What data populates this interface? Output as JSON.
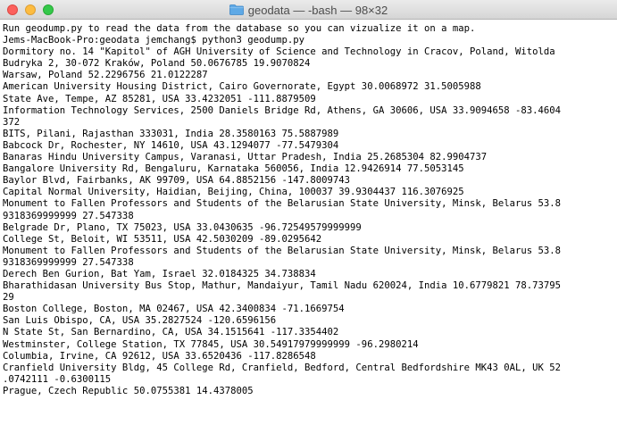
{
  "window": {
    "title": "geodata — -bash — 98×32",
    "icon": "folder-icon",
    "colors": {
      "close": "#fc605c",
      "minimize": "#fdbc40",
      "zoom": "#34c84a",
      "folder": "#5ea9e6"
    }
  },
  "terminal": {
    "lines": [
      "Run geodump.py to read the data from the database so you can vizualize it on a map.",
      "Jems-MacBook-Pro:geodata jemchang$ python3 geodump.py",
      "Dormitory no. 14 \"Kapitol\" of AGH University of Science and Technology in Cracov, Poland, Witolda",
      "Budryka 2, 30-072 Kraków, Poland 50.0676785 19.9070824",
      "Warsaw, Poland 52.2296756 21.0122287",
      "American University Housing District, Cairo Governorate, Egypt 30.0068972 31.5005988",
      "State Ave, Tempe, AZ 85281, USA 33.4232051 -111.8879509",
      "Information Technology Services, 2500 Daniels Bridge Rd, Athens, GA 30606, USA 33.9094658 -83.4604",
      "372",
      "BITS, Pilani, Rajasthan 333031, India 28.3580163 75.5887989",
      "Babcock Dr, Rochester, NY 14610, USA 43.1294077 -77.5479304",
      "Banaras Hindu University Campus, Varanasi, Uttar Pradesh, India 25.2685304 82.9904737",
      "Bangalore University Rd, Bengaluru, Karnataka 560056, India 12.9426914 77.5053145",
      "Baylor Blvd, Fairbanks, AK 99709, USA 64.8852156 -147.8009743",
      "Capital Normal University, Haidian, Beijing, China, 100037 39.9304437 116.3076925",
      "Monument to Fallen Professors and Students of the Belarusian State University, Minsk, Belarus 53.8",
      "9318369999999 27.547338",
      "Belgrade Dr, Plano, TX 75023, USA 33.0430635 -96.72549579999999",
      "College St, Beloit, WI 53511, USA 42.5030209 -89.0295642",
      "Monument to Fallen Professors and Students of the Belarusian State University, Minsk, Belarus 53.8",
      "9318369999999 27.547338",
      "Derech Ben Gurion, Bat Yam, Israel 32.0184325 34.738834",
      "Bharathidasan University Bus Stop, Mathur, Mandaiyur, Tamil Nadu 620024, India 10.6779821 78.73795",
      "29",
      "Boston College, Boston, MA 02467, USA 42.3400834 -71.1669754",
      "San Luis Obispo, CA, USA 35.2827524 -120.6596156",
      "N State St, San Bernardino, CA, USA 34.1515641 -117.3354402",
      "Westminster, College Station, TX 77845, USA 30.54917979999999 -96.2980214",
      "Columbia, Irvine, CA 92612, USA 33.6520436 -117.8286548",
      "Cranfield University Bldg, 45 College Rd, Cranfield, Bedford, Central Bedfordshire MK43 0AL, UK 52",
      ".0742111 -0.6300115",
      "Prague, Czech Republic 50.0755381 14.4378005"
    ]
  }
}
